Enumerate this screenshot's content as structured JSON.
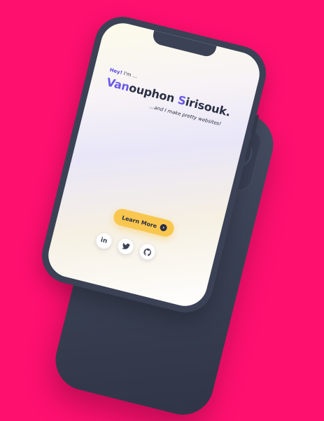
{
  "hero": {
    "greeting_prefix": "Hey!",
    "greeting_rest": " I'm ...",
    "name_accent_1": "Van",
    "name_rest_1": "ouphon ",
    "name_accent_2": "S",
    "name_rest_2": "irisouk.",
    "tagline": "...and I make pretty websites!"
  },
  "cta": {
    "label": "Learn More",
    "icon": "arrow-right-icon",
    "color": "#F9C74F"
  },
  "socials": [
    {
      "name": "linkedin",
      "glyph": "in",
      "icon": "linkedin-icon"
    },
    {
      "name": "twitter",
      "glyph": "",
      "icon": "twitter-icon"
    },
    {
      "name": "github",
      "glyph": "",
      "icon": "github-icon"
    }
  ],
  "colors": {
    "background": "#FE106F",
    "phone_body": "#3B4255",
    "accent": "#6A5AE6"
  }
}
